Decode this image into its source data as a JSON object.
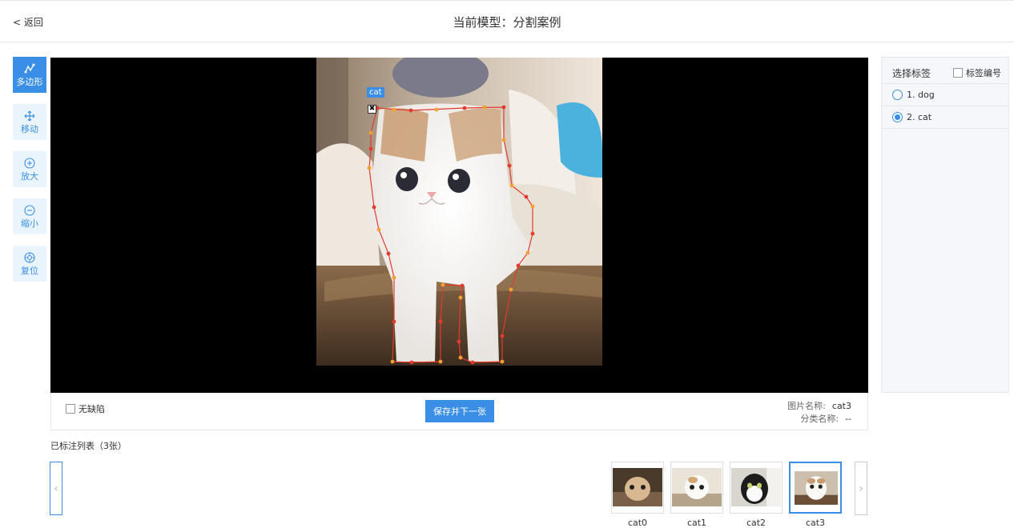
{
  "header": {
    "back": "< 返回",
    "title": "当前模型：分割案例"
  },
  "tools": [
    {
      "label": "多边形",
      "icon": "polygon-icon",
      "active": true
    },
    {
      "label": "移动",
      "icon": "move-icon"
    },
    {
      "label": "放大",
      "icon": "zoom-in-icon"
    },
    {
      "label": "缩小",
      "icon": "zoom-out-icon"
    },
    {
      "label": "复位",
      "icon": "reset-icon"
    }
  ],
  "canvas": {
    "annotation_label": "cat",
    "delete_glyph": "✖"
  },
  "bottom_bar": {
    "no_defect": "无缺陷",
    "save_button": "保存并下一张",
    "image_name_label": "图片名称:",
    "image_name_value": "cat3",
    "class_name_label": "分类名称:",
    "class_name_value": "--"
  },
  "side_panel": {
    "title": "选择标签",
    "label_number_toggle": "标签编号",
    "labels": [
      {
        "text": "1. dog",
        "selected": false
      },
      {
        "text": "2. cat",
        "selected": true
      }
    ]
  },
  "list": {
    "title": "已标注列表（3张）",
    "thumbnails": [
      {
        "name": "cat0"
      },
      {
        "name": "cat1"
      },
      {
        "name": "cat2"
      },
      {
        "name": "cat3",
        "selected": true
      }
    ],
    "prev": "‹",
    "next": "›"
  },
  "colors": {
    "accent": "#3a8ee6",
    "polygon_line": "#e23b2e",
    "vertex_a": "#e23b2e",
    "vertex_b": "#f5a030"
  }
}
